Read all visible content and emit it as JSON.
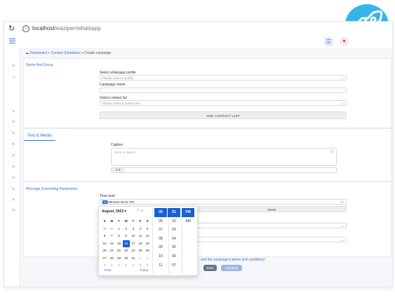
{
  "browser": {
    "url_host": "localhost",
    "url_path": "/waziper/whatsapp",
    "reload_icon": "↻"
  },
  "header": {
    "menu_icon": "hamburger-icon",
    "list_icon": "☰",
    "bell_icon": "▼"
  },
  "breadcrumb": {
    "home_icon": "☁",
    "dashboard": "Dashboard",
    "sep1": ">",
    "schedules": "Contact Schedules",
    "sep2": ">",
    "current": "Create campaign"
  },
  "sidebar": {
    "chevrons": [
      ">",
      "⌄",
      ">",
      ">",
      ">",
      ">",
      ">",
      ">",
      ">",
      ">",
      ">",
      ">"
    ]
  },
  "name_group": {
    "title": "Name And Group",
    "profile_label": "Select whatsapp profile",
    "profile_placeholder": "Please select a profile",
    "campaign_label": "Campaign name",
    "campaign_value": "",
    "contact_label": "Select contact list",
    "contact_placeholder": "Please select a contact list",
    "add_button": "ADD CONTACT LIST"
  },
  "text_media": {
    "tab": "Text & Media",
    "caption_label": "Caption",
    "caption_placeholder": "Write a caption",
    "emoji_icon": "☺",
    "count": "0"
  },
  "scheduling": {
    "title": "Message Scheduling Parameters",
    "time_label": "Time post",
    "time_value_day": "16",
    "time_value_rest": "/08/2023 05:51 PM",
    "now_button": "NOW"
  },
  "calendar": {
    "month": "August, 2023",
    "dropdown_caret": "▾",
    "up": "↑",
    "down": "↓",
    "weekdays": [
      "S",
      "M",
      "T",
      "W",
      "T",
      "F",
      "S"
    ],
    "weeks": [
      [
        "30",
        "31",
        "1",
        "2",
        "3",
        "4",
        "5"
      ],
      [
        "6",
        "7",
        "8",
        "9",
        "10",
        "11",
        "12"
      ],
      [
        "13",
        "14",
        "15",
        "16",
        "17",
        "18",
        "19"
      ],
      [
        "20",
        "21",
        "22",
        "23",
        "24",
        "25",
        "26"
      ],
      [
        "27",
        "28",
        "29",
        "30",
        "31",
        "1",
        "2"
      ],
      [
        "3",
        "4",
        "5",
        "6",
        "7",
        "8",
        "9"
      ]
    ],
    "selected": "16",
    "clear": "Clear",
    "today": "Today",
    "hours": [
      "05",
      "06",
      "07",
      "08",
      "09",
      "10",
      "11"
    ],
    "minutes": [
      "51",
      "52",
      "53",
      "54",
      "55",
      "56",
      "57"
    ],
    "ampm": [
      "PM",
      "AM"
    ]
  },
  "footer": {
    "terms_text": "and the campaign's terms and conditions\"",
    "back": "Back",
    "schedule": "Schedule"
  },
  "colors": {
    "accent": "#3b6fd8",
    "selected": "#1a5fd6",
    "rocket_bg": "#35b6ea"
  }
}
